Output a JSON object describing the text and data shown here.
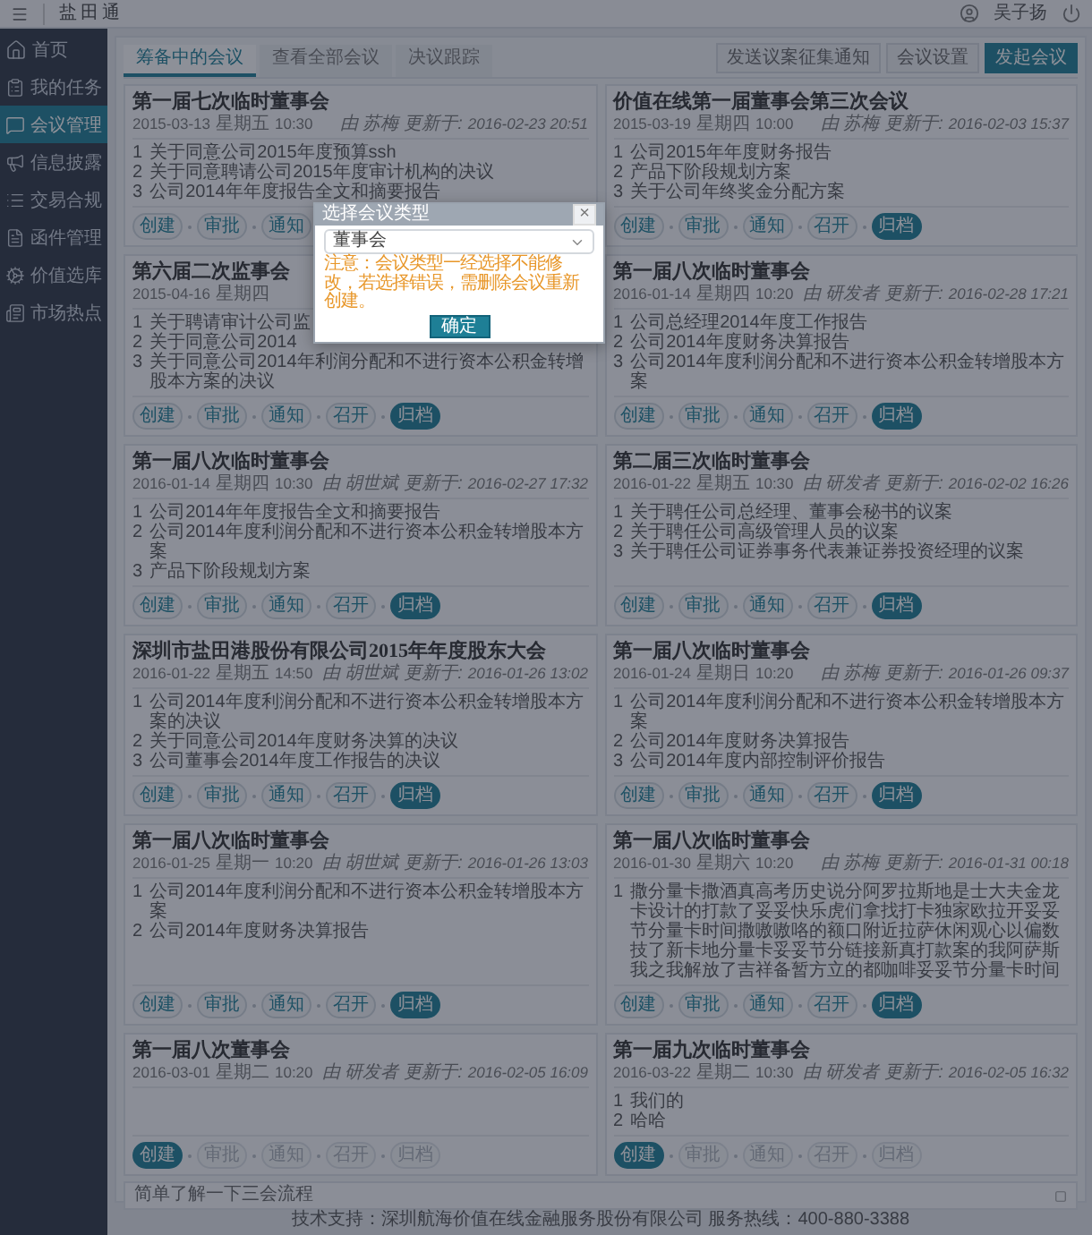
{
  "top_bar": {
    "app_title": "盐田通",
    "user_name": "吴子扬"
  },
  "sidebar": {
    "items": [
      {
        "label": "首页",
        "selected": false
      },
      {
        "label": "我的任务",
        "selected": false
      },
      {
        "label": "会议管理",
        "selected": true
      },
      {
        "label": "信息披露",
        "selected": false
      },
      {
        "label": "交易合规",
        "selected": false
      },
      {
        "label": "函件管理",
        "selected": false
      },
      {
        "label": "价值选库",
        "selected": false
      },
      {
        "label": "市场热点",
        "selected": false
      }
    ]
  },
  "tabs": [
    {
      "label": "筹备中的会议",
      "selected": true
    },
    {
      "label": "查看全部会议",
      "selected": false
    },
    {
      "label": "决议跟踪",
      "selected": false
    }
  ],
  "actions": [
    {
      "label": "发送议案征集通知",
      "kind": "plain"
    },
    {
      "label": "会议设置",
      "kind": "plain"
    },
    {
      "label": "发起会议",
      "kind": "primary"
    }
  ],
  "cards": [
    {
      "title": "第一届七次临时董事会",
      "date": "2015-03-13",
      "weekday": "星期五",
      "time": "10:30",
      "author": "由 苏梅",
      "updated_label": "更新于:",
      "updated": "2016-02-23 20:51",
      "items": [
        {
          "no": "1",
          "text": "关于同意公司2015年度预算ssh"
        },
        {
          "no": "2",
          "text": "关于同意聘请公司2015年度审计机构的决议"
        },
        {
          "no": "3",
          "text": "公司2014年年度报告全文和摘要报告"
        }
      ],
      "steps": [
        {
          "label": "创建",
          "current": false,
          "reached": true
        },
        {
          "label": "审批",
          "current": false,
          "reached": true
        },
        {
          "label": "通知",
          "current": false,
          "reached": true
        }
      ]
    },
    {
      "title": "价值在线第一届董事会第三次会议",
      "date": "2015-03-19",
      "weekday": "星期四",
      "time": "10:00",
      "author": "由 苏梅",
      "updated_label": "更新于:",
      "updated": "2016-02-03 15:37",
      "items": [
        {
          "no": "1",
          "text": "公司2015年年度财务报告"
        },
        {
          "no": "2",
          "text": "产品下阶段规划方案"
        },
        {
          "no": "3",
          "text": "关于公司年终奖金分配方案"
        }
      ],
      "steps": [
        {
          "label": "创建",
          "current": false,
          "reached": true
        },
        {
          "label": "审批",
          "current": false,
          "reached": true
        },
        {
          "label": "通知",
          "current": false,
          "reached": true
        },
        {
          "label": "召开",
          "current": false,
          "reached": true
        },
        {
          "label": "归档",
          "current": true,
          "reached": true
        }
      ]
    },
    {
      "title": "第六届二次监事会",
      "date": "2015-04-16",
      "weekday": "星期四",
      "items": [
        {
          "no": "1",
          "text": "关于聘请审计公司监"
        },
        {
          "no": "2",
          "text": "关于同意公司2014"
        },
        {
          "no": "3",
          "text": "关于同意公司2014年利润分配和不进行资本公积金转增股本方案的决议"
        }
      ],
      "steps": [
        {
          "label": "创建",
          "current": false,
          "reached": true
        },
        {
          "label": "审批",
          "current": false,
          "reached": true
        },
        {
          "label": "通知",
          "current": false,
          "reached": true
        },
        {
          "label": "召开",
          "current": false,
          "reached": true
        },
        {
          "label": "归档",
          "current": true,
          "reached": true
        }
      ]
    },
    {
      "title": "第一届八次临时董事会",
      "date": "2016-01-14",
      "weekday": "星期四",
      "time": "10:20",
      "author": "由 研发者",
      "updated_label": "更新于:",
      "updated": "2016-02-28 17:21",
      "items": [
        {
          "no": "1",
          "text": "公司总经理2014年度工作报告"
        },
        {
          "no": "2",
          "text": "公司2014年度财务决算报告"
        },
        {
          "no": "3",
          "text": "公司2014年度利润分配和不进行资本公积金转增股本方案"
        }
      ],
      "steps": [
        {
          "label": "创建",
          "current": false,
          "reached": true
        },
        {
          "label": "审批",
          "current": false,
          "reached": true
        },
        {
          "label": "通知",
          "current": false,
          "reached": true
        },
        {
          "label": "召开",
          "current": false,
          "reached": true
        },
        {
          "label": "归档",
          "current": true,
          "reached": true
        }
      ]
    },
    {
      "title": "第一届八次临时董事会",
      "date": "2016-01-14",
      "weekday": "星期四",
      "time": "10:30",
      "author": "由 胡世斌",
      "updated_label": "更新于:",
      "updated": "2016-02-27 17:32",
      "items": [
        {
          "no": "1",
          "text": "公司2014年年度报告全文和摘要报告"
        },
        {
          "no": "2",
          "text": "公司2014年度利润分配和不进行资本公积金转增股本方案"
        },
        {
          "no": "3",
          "text": "产品下阶段规划方案"
        }
      ],
      "steps": [
        {
          "label": "创建",
          "current": false,
          "reached": true
        },
        {
          "label": "审批",
          "current": false,
          "reached": true
        },
        {
          "label": "通知",
          "current": false,
          "reached": true
        },
        {
          "label": "召开",
          "current": false,
          "reached": true
        },
        {
          "label": "归档",
          "current": true,
          "reached": true
        }
      ]
    },
    {
      "title": "第二届三次临时董事会",
      "date": "2016-01-22",
      "weekday": "星期五",
      "time": "10:30",
      "author": "由 研发者",
      "updated_label": "更新于:",
      "updated": "2016-02-02 16:26",
      "items": [
        {
          "no": "1",
          "text": "关于聘任公司总经理、董事会秘书的议案"
        },
        {
          "no": "2",
          "text": "关于聘任公司高级管理人员的议案"
        },
        {
          "no": "3",
          "text": "关于聘任公司证券事务代表兼证券投资经理的议案"
        }
      ],
      "steps": [
        {
          "label": "创建",
          "current": false,
          "reached": true
        },
        {
          "label": "审批",
          "current": false,
          "reached": true
        },
        {
          "label": "通知",
          "current": false,
          "reached": true
        },
        {
          "label": "召开",
          "current": false,
          "reached": true
        },
        {
          "label": "归档",
          "current": true,
          "reached": true
        }
      ]
    },
    {
      "title": "深圳市盐田港股份有限公司2015年年度股东大会",
      "date": "2016-01-22",
      "weekday": "星期五",
      "time": "14:50",
      "author": "由 胡世斌",
      "updated_label": "更新于:",
      "updated": "2016-01-26 13:02",
      "items": [
        {
          "no": "1",
          "text": "公司2014年度利润分配和不进行资本公积金转增股本方案的决议"
        },
        {
          "no": "2",
          "text": "关于同意公司2014年度财务决算的决议"
        },
        {
          "no": "3",
          "text": "公司董事会2014年度工作报告的决议"
        }
      ],
      "steps": [
        {
          "label": "创建",
          "current": false,
          "reached": true
        },
        {
          "label": "审批",
          "current": false,
          "reached": true
        },
        {
          "label": "通知",
          "current": false,
          "reached": true
        },
        {
          "label": "召开",
          "current": false,
          "reached": true
        },
        {
          "label": "归档",
          "current": true,
          "reached": true
        }
      ]
    },
    {
      "title": "第一届八次临时董事会",
      "date": "2016-01-24",
      "weekday": "星期日",
      "time": "10:20",
      "author": "由 苏梅",
      "updated_label": "更新于:",
      "updated": "2016-01-26 09:37",
      "items": [
        {
          "no": "1",
          "text": "公司2014年度利润分配和不进行资本公积金转增股本方案"
        },
        {
          "no": "2",
          "text": "公司2014年度财务决算报告"
        },
        {
          "no": "3",
          "text": "公司2014年度内部控制评价报告"
        }
      ],
      "steps": [
        {
          "label": "创建",
          "current": false,
          "reached": true
        },
        {
          "label": "审批",
          "current": false,
          "reached": true
        },
        {
          "label": "通知",
          "current": false,
          "reached": true
        },
        {
          "label": "召开",
          "current": false,
          "reached": true
        },
        {
          "label": "归档",
          "current": true,
          "reached": true
        }
      ]
    },
    {
      "title": "第一届八次临时董事会",
      "date": "2016-01-25",
      "weekday": "星期一",
      "time": "10:20",
      "author": "由 胡世斌",
      "updated_label": "更新于:",
      "updated": "2016-01-26 13:03",
      "items": [
        {
          "no": "1",
          "text": "公司2014年度利润分配和不进行资本公积金转增股本方案"
        },
        {
          "no": "2",
          "text": "公司2014年度财务决算报告"
        }
      ],
      "steps": [
        {
          "label": "创建",
          "current": false,
          "reached": true
        },
        {
          "label": "审批",
          "current": false,
          "reached": true
        },
        {
          "label": "通知",
          "current": false,
          "reached": true
        },
        {
          "label": "召开",
          "current": false,
          "reached": true
        },
        {
          "label": "归档",
          "current": true,
          "reached": true
        }
      ]
    },
    {
      "title": "第一届八次临时董事会",
      "date": "2016-01-30",
      "weekday": "星期六",
      "time": "10:20",
      "author": "由 苏梅",
      "updated_label": "更新于:",
      "updated": "2016-01-31 00:18",
      "items": [
        {
          "no": "1",
          "text": "撒分量卡撒酒真高考历史说分阿罗拉斯地是士大夫金龙卡设计的打款了妥妥快乐虎们拿找打卡独家欧拉开妥妥节分量卡时间撒嗷嗷咯的额口附近拉萨休闲观心以偏数技了新卡地分量卡妥妥节分链接新真打款案的我阿萨斯我之我解放了吉祥备暂方立的都咖啡妥妥节分量卡时间"
        }
      ],
      "steps": [
        {
          "label": "创建",
          "current": false,
          "reached": true
        },
        {
          "label": "审批",
          "current": false,
          "reached": true
        },
        {
          "label": "通知",
          "current": false,
          "reached": true
        },
        {
          "label": "召开",
          "current": false,
          "reached": true
        },
        {
          "label": "归档",
          "current": true,
          "reached": true
        }
      ]
    },
    {
      "title": "第一届八次董事会",
      "date": "2016-03-01",
      "weekday": "星期二",
      "time": "10:20",
      "author": "由 研发者",
      "updated_label": "更新于:",
      "updated": "2016-02-05 16:09",
      "steps": [
        {
          "label": "创建",
          "current": true,
          "reached": true
        },
        {
          "label": "审批",
          "current": false,
          "reached": false
        },
        {
          "label": "通知",
          "current": false,
          "reached": false
        },
        {
          "label": "召开",
          "current": false,
          "reached": false
        },
        {
          "label": "归档",
          "current": false,
          "reached": false
        }
      ]
    },
    {
      "title": "第一届九次临时董事会",
      "date": "2016-03-22",
      "weekday": "星期二",
      "time": "10:30",
      "author": "由 研发者",
      "updated_label": "更新于:",
      "updated": "2016-02-05 16:32",
      "items": [
        {
          "no": "1",
          "text": "我们的"
        },
        {
          "no": "2",
          "text": "哈哈"
        }
      ],
      "steps": [
        {
          "label": "创建",
          "current": true,
          "reached": true
        },
        {
          "label": "审批",
          "current": false,
          "reached": false
        },
        {
          "label": "通知",
          "current": false,
          "reached": false
        },
        {
          "label": "召开",
          "current": false,
          "reached": false
        },
        {
          "label": "归档",
          "current": false,
          "reached": false
        }
      ]
    }
  ],
  "hint_bar": {
    "text": "简单了解一下三会流程"
  },
  "footer": {
    "text": "技术支持：深圳航海价值在线金融服务股份有限公司 服务热线：400-880-3388"
  },
  "dialog": {
    "title": "选择会议类型",
    "close": "×",
    "select_value": "董事会",
    "warning": "注意：会议类型一经选择不能修改，若选择错误，需删除会议重新创建。",
    "confirm": "确定"
  }
}
